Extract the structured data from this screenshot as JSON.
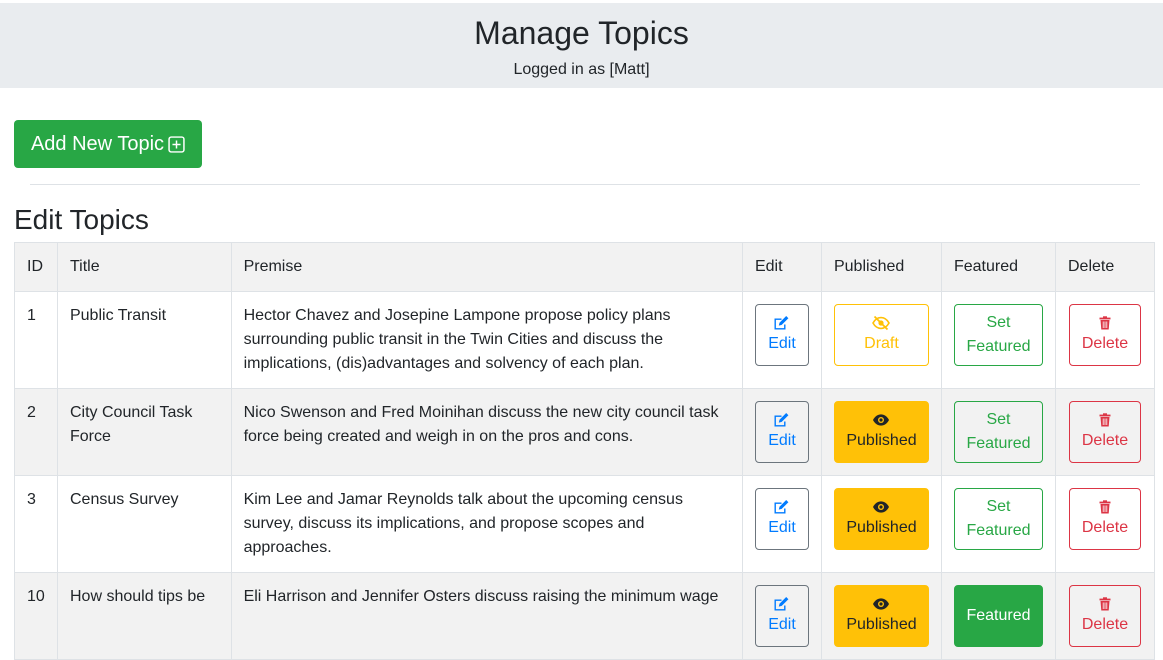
{
  "header": {
    "title": "Manage Topics",
    "logged_in": "Logged in as [Matt]"
  },
  "add_button": {
    "label": "Add New Topic",
    "icon": "plus-square-icon"
  },
  "section_title": "Edit Topics",
  "columns": [
    "ID",
    "Title",
    "Premise",
    "Edit",
    "Published",
    "Featured",
    "Delete"
  ],
  "rows": [
    {
      "id": "1",
      "title": "Public Transit",
      "premise": "Hector Chavez and Josepine Lampone propose policy plans surrounding public transit in the Twin Cities and discuss the implications, (dis)advantages and solvency of each plan.",
      "edit_label": "Edit",
      "published_label": "Draft",
      "published_state": "draft",
      "featured_label": "Set Featured",
      "featured_state": "not-featured",
      "delete_label": "Delete"
    },
    {
      "id": "2",
      "title": "City Council Task Force",
      "premise": "Nico Swenson and Fred Moinihan discuss the new city council task force being created and weigh in on the pros and cons.",
      "edit_label": "Edit",
      "published_label": "Published",
      "published_state": "published",
      "featured_label": "Set Featured",
      "featured_state": "not-featured",
      "delete_label": "Delete"
    },
    {
      "id": "3",
      "title": "Census Survey",
      "premise": "Kim Lee and Jamar Reynolds talk about the upcoming census survey, discuss its implications, and propose scopes and approaches.",
      "edit_label": "Edit",
      "published_label": "Published",
      "published_state": "published",
      "featured_label": "Set Featured",
      "featured_state": "not-featured",
      "delete_label": "Delete"
    },
    {
      "id": "10",
      "title": "How should tips be",
      "premise": "Eli Harrison and Jennifer Osters discuss raising the minimum wage",
      "edit_label": "Edit",
      "published_label": "Published",
      "published_state": "published",
      "featured_label": "Featured",
      "featured_state": "featured",
      "delete_label": "Delete"
    }
  ],
  "colors": {
    "success": "#28a745",
    "primary": "#007bff",
    "warning": "#ffc107",
    "danger": "#dc3545",
    "secondary": "#6c757d",
    "header_bg": "#e9ecef"
  }
}
